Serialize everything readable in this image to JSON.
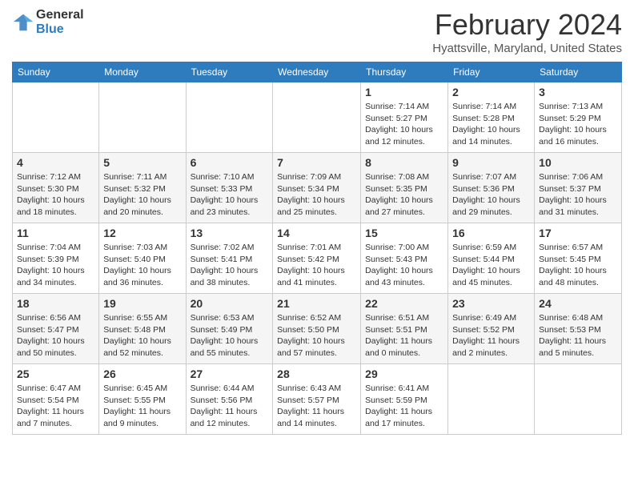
{
  "header": {
    "logo_line1": "General",
    "logo_line2": "Blue",
    "month": "February 2024",
    "location": "Hyattsville, Maryland, United States"
  },
  "days_of_week": [
    "Sunday",
    "Monday",
    "Tuesday",
    "Wednesday",
    "Thursday",
    "Friday",
    "Saturday"
  ],
  "weeks": [
    [
      {
        "day": "",
        "info": ""
      },
      {
        "day": "",
        "info": ""
      },
      {
        "day": "",
        "info": ""
      },
      {
        "day": "",
        "info": ""
      },
      {
        "day": "1",
        "info": "Sunrise: 7:14 AM\nSunset: 5:27 PM\nDaylight: 10 hours\nand 12 minutes."
      },
      {
        "day": "2",
        "info": "Sunrise: 7:14 AM\nSunset: 5:28 PM\nDaylight: 10 hours\nand 14 minutes."
      },
      {
        "day": "3",
        "info": "Sunrise: 7:13 AM\nSunset: 5:29 PM\nDaylight: 10 hours\nand 16 minutes."
      }
    ],
    [
      {
        "day": "4",
        "info": "Sunrise: 7:12 AM\nSunset: 5:30 PM\nDaylight: 10 hours\nand 18 minutes."
      },
      {
        "day": "5",
        "info": "Sunrise: 7:11 AM\nSunset: 5:32 PM\nDaylight: 10 hours\nand 20 minutes."
      },
      {
        "day": "6",
        "info": "Sunrise: 7:10 AM\nSunset: 5:33 PM\nDaylight: 10 hours\nand 23 minutes."
      },
      {
        "day": "7",
        "info": "Sunrise: 7:09 AM\nSunset: 5:34 PM\nDaylight: 10 hours\nand 25 minutes."
      },
      {
        "day": "8",
        "info": "Sunrise: 7:08 AM\nSunset: 5:35 PM\nDaylight: 10 hours\nand 27 minutes."
      },
      {
        "day": "9",
        "info": "Sunrise: 7:07 AM\nSunset: 5:36 PM\nDaylight: 10 hours\nand 29 minutes."
      },
      {
        "day": "10",
        "info": "Sunrise: 7:06 AM\nSunset: 5:37 PM\nDaylight: 10 hours\nand 31 minutes."
      }
    ],
    [
      {
        "day": "11",
        "info": "Sunrise: 7:04 AM\nSunset: 5:39 PM\nDaylight: 10 hours\nand 34 minutes."
      },
      {
        "day": "12",
        "info": "Sunrise: 7:03 AM\nSunset: 5:40 PM\nDaylight: 10 hours\nand 36 minutes."
      },
      {
        "day": "13",
        "info": "Sunrise: 7:02 AM\nSunset: 5:41 PM\nDaylight: 10 hours\nand 38 minutes."
      },
      {
        "day": "14",
        "info": "Sunrise: 7:01 AM\nSunset: 5:42 PM\nDaylight: 10 hours\nand 41 minutes."
      },
      {
        "day": "15",
        "info": "Sunrise: 7:00 AM\nSunset: 5:43 PM\nDaylight: 10 hours\nand 43 minutes."
      },
      {
        "day": "16",
        "info": "Sunrise: 6:59 AM\nSunset: 5:44 PM\nDaylight: 10 hours\nand 45 minutes."
      },
      {
        "day": "17",
        "info": "Sunrise: 6:57 AM\nSunset: 5:45 PM\nDaylight: 10 hours\nand 48 minutes."
      }
    ],
    [
      {
        "day": "18",
        "info": "Sunrise: 6:56 AM\nSunset: 5:47 PM\nDaylight: 10 hours\nand 50 minutes."
      },
      {
        "day": "19",
        "info": "Sunrise: 6:55 AM\nSunset: 5:48 PM\nDaylight: 10 hours\nand 52 minutes."
      },
      {
        "day": "20",
        "info": "Sunrise: 6:53 AM\nSunset: 5:49 PM\nDaylight: 10 hours\nand 55 minutes."
      },
      {
        "day": "21",
        "info": "Sunrise: 6:52 AM\nSunset: 5:50 PM\nDaylight: 10 hours\nand 57 minutes."
      },
      {
        "day": "22",
        "info": "Sunrise: 6:51 AM\nSunset: 5:51 PM\nDaylight: 11 hours\nand 0 minutes."
      },
      {
        "day": "23",
        "info": "Sunrise: 6:49 AM\nSunset: 5:52 PM\nDaylight: 11 hours\nand 2 minutes."
      },
      {
        "day": "24",
        "info": "Sunrise: 6:48 AM\nSunset: 5:53 PM\nDaylight: 11 hours\nand 5 minutes."
      }
    ],
    [
      {
        "day": "25",
        "info": "Sunrise: 6:47 AM\nSunset: 5:54 PM\nDaylight: 11 hours\nand 7 minutes."
      },
      {
        "day": "26",
        "info": "Sunrise: 6:45 AM\nSunset: 5:55 PM\nDaylight: 11 hours\nand 9 minutes."
      },
      {
        "day": "27",
        "info": "Sunrise: 6:44 AM\nSunset: 5:56 PM\nDaylight: 11 hours\nand 12 minutes."
      },
      {
        "day": "28",
        "info": "Sunrise: 6:43 AM\nSunset: 5:57 PM\nDaylight: 11 hours\nand 14 minutes."
      },
      {
        "day": "29",
        "info": "Sunrise: 6:41 AM\nSunset: 5:59 PM\nDaylight: 11 hours\nand 17 minutes."
      },
      {
        "day": "",
        "info": ""
      },
      {
        "day": "",
        "info": ""
      }
    ]
  ]
}
